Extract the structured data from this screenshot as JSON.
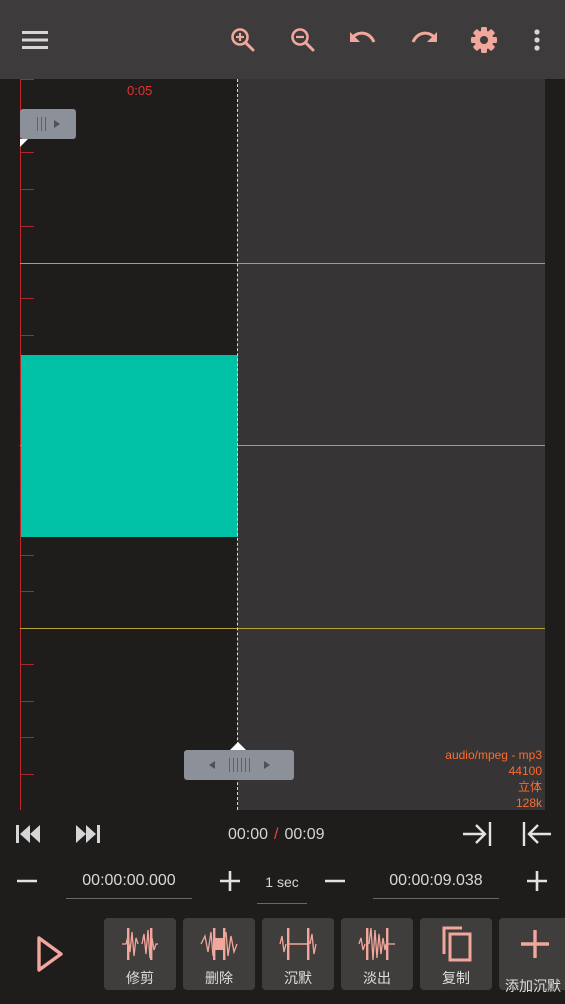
{
  "toolbar": {
    "menu_icon": "menu-icon",
    "zoom_in_icon": "zoom-in-icon",
    "zoom_out_icon": "zoom-out-icon",
    "undo_icon": "undo-icon",
    "redo_icon": "redo-icon",
    "settings_icon": "settings-icon",
    "more_icon": "more-vert-icon"
  },
  "waveform": {
    "time_marker": "0:05",
    "file_info": {
      "format": "audio/mpeg - mp3",
      "sample_rate": "44100",
      "channels": "立体",
      "bitrate": "128k"
    }
  },
  "transport": {
    "current_time": "00:00",
    "separator": "/",
    "total_time": "00:09"
  },
  "position": {
    "start_value": "00:00:00.000",
    "step_value": "1 sec",
    "end_value": "00:00:09.038"
  },
  "tools": [
    {
      "label": "修剪",
      "icon": "trim-icon"
    },
    {
      "label": "删除",
      "icon": "delete-icon"
    },
    {
      "label": "沉默",
      "icon": "silence-icon"
    },
    {
      "label": "淡出",
      "icon": "fade-out-icon"
    },
    {
      "label": "复制",
      "icon": "copy-icon"
    },
    {
      "label": "添加沉默",
      "icon": "add-silence-icon"
    }
  ],
  "colors": {
    "accent": "#f2a79c",
    "selection": "#00c1a6",
    "info_text": "#ff6b2e",
    "time_marker": "#e13535"
  }
}
